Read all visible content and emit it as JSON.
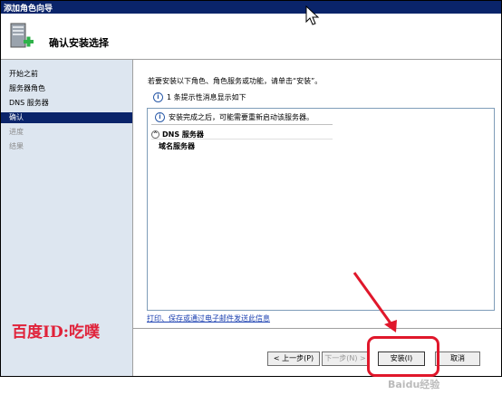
{
  "window": {
    "title": "添加角色向导"
  },
  "header": {
    "title": "确认安装选择",
    "icon": "server-add-icon"
  },
  "sidebar": {
    "items": [
      {
        "label": "开始之前",
        "state": "normal"
      },
      {
        "label": "服务器角色",
        "state": "normal"
      },
      {
        "label": "DNS 服务器",
        "state": "normal"
      },
      {
        "label": "确认",
        "state": "active"
      },
      {
        "label": "进度",
        "state": "disabled"
      },
      {
        "label": "结果",
        "state": "disabled"
      }
    ]
  },
  "main": {
    "instruction": "若要安装以下角色、角色服务或功能，请单击“安装”。",
    "info_message": "1 条提示性消息显示如下",
    "box": {
      "note": "安装完成之后，可能需要重新启动该服务器。",
      "role_title": "DNS 服务器",
      "role_item": "域名服务器"
    },
    "print_link": "打印、保存或通过电子邮件发送此信息"
  },
  "buttons": {
    "prev": "< 上一步(P)",
    "next": "下一步(N) >",
    "install": "安装(I)",
    "cancel": "取消"
  },
  "overlay": {
    "watermark_text": "百度ID:吃噗",
    "baidu_logo": "Baidu经验"
  },
  "colors": {
    "accent": "#0a246a",
    "annotation": "#e0172b"
  }
}
